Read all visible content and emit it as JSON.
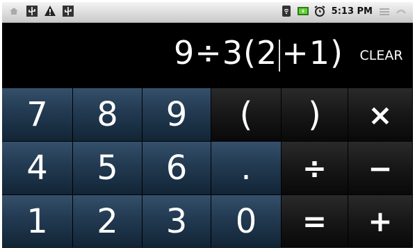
{
  "status_bar": {
    "time": "5:13 PM",
    "left_icons": [
      "home-icon",
      "usb-icon",
      "warning-icon",
      "usb-icon"
    ],
    "right_icons": [
      "wifi-icon",
      "battery-charging-icon",
      "alarm-icon",
      "signal-icon",
      "phone-icon"
    ]
  },
  "display": {
    "expression_before_cursor": "9÷3(2",
    "expression_after_cursor": "+1)"
  },
  "clear_label": "CLEAR",
  "keys": {
    "k7": "7",
    "k8": "8",
    "k9": "9",
    "lparen": "(",
    "rparen": ")",
    "multiply": "×",
    "k4": "4",
    "k5": "5",
    "k6": "6",
    "dot": ".",
    "divide": "÷",
    "minus": "−",
    "k1": "1",
    "k2": "2",
    "k3": "3",
    "k0": "0",
    "equals": "=",
    "plus": "+"
  },
  "colors": {
    "number_key": "#223a51",
    "op_key": "#171717",
    "display_bg": "#000000"
  }
}
